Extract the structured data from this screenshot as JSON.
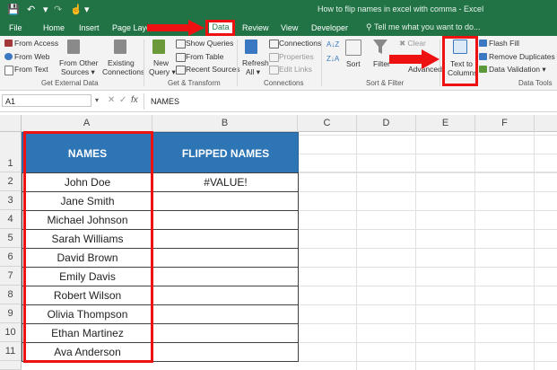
{
  "window": {
    "title": "How to flip names in excel with comma - Excel"
  },
  "tabs": [
    {
      "label": "File"
    },
    {
      "label": "Home"
    },
    {
      "label": "Insert"
    },
    {
      "label": "Page Layo"
    },
    {
      "label": "as"
    },
    {
      "label": "Data"
    },
    {
      "label": "Review"
    },
    {
      "label": "View"
    },
    {
      "label": "Developer"
    }
  ],
  "tellme": "Tell me what you want to do...",
  "ribbon": {
    "get_external": {
      "from_access": "From Access",
      "from_web": "From Web",
      "from_text": "From Text",
      "other_sources": [
        "From Other",
        "Sources ▾"
      ],
      "existing": [
        "Existing",
        "Connections"
      ],
      "group": "Get External Data"
    },
    "transform": {
      "new_query": [
        "New",
        "Query ▾"
      ],
      "show_queries": "Show Queries",
      "from_table": "From Table",
      "recent_sources": "Recent Sources",
      "group": "Get & Transform"
    },
    "connections": {
      "refresh": [
        "Refresh",
        "All ▾"
      ],
      "connections": "Connections",
      "properties": "Properties",
      "edit_links": "Edit Links",
      "group": "Connections"
    },
    "sort_filter": {
      "sort": "Sort",
      "filter": "Filter",
      "clear": "Clear",
      "advanced": "Advanced",
      "group": "Sort & Filter"
    },
    "data_tools": {
      "text_to_columns": [
        "Text to",
        "Columns"
      ],
      "flash_fill": "Flash Fill",
      "remove_duplicates": "Remove Duplicates",
      "data_validation": "Data Validation",
      "group": "Data Tools"
    }
  },
  "formula_bar": {
    "name_box": "A1",
    "fx": "fx",
    "value": "NAMES"
  },
  "columns": [
    "A",
    "B",
    "C",
    "D",
    "E",
    "F"
  ],
  "rows": [
    "1",
    "2",
    "3",
    "4",
    "5",
    "6",
    "7",
    "8",
    "9",
    "10",
    "11"
  ],
  "sheet": {
    "header_a": "NAMES",
    "header_b": "FLIPPED NAMES",
    "names": [
      "John Doe",
      "Jane Smith",
      "Michael Johnson",
      "Sarah Williams",
      "David Brown",
      "Emily Davis",
      "Robert Wilson",
      "Olivia Thompson",
      "Ethan Martinez",
      "Ava Anderson"
    ],
    "flipped": [
      "#VALUE!",
      "",
      "",
      "",
      "",
      "",
      "",
      "",
      "",
      ""
    ]
  },
  "colors": {
    "excel_green": "#217346",
    "header_fill": "#2e75b6",
    "highlight": "#ee1111"
  }
}
